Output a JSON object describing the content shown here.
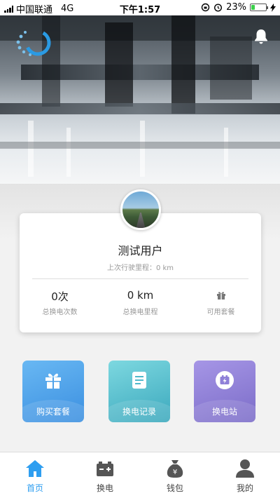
{
  "status_bar": {
    "carrier": "中国联通",
    "network": "4G",
    "time": "下午1:57",
    "battery_percent": "23%",
    "battery_level": 0.23
  },
  "header": {
    "logo_icon": "ring-logo-icon",
    "notification_icon": "bell-icon"
  },
  "profile": {
    "username": "测试用户",
    "last_mileage": "上次行驶里程：0 km",
    "stats": [
      {
        "value": "0次",
        "label": "总换电次数"
      },
      {
        "value": "0 km",
        "label": "总换电里程"
      },
      {
        "value": "",
        "label": "可用套餐",
        "icon": "gift-icon"
      }
    ]
  },
  "actions": [
    {
      "label": "购买套餐",
      "icon": "gift-icon",
      "color": "#4ea2ea"
    },
    {
      "label": "换电记录",
      "icon": "document-icon",
      "color": "#4fb9cb"
    },
    {
      "label": "换电站",
      "icon": "battery-station-icon",
      "color": "#8f80d8"
    }
  ],
  "tabbar": {
    "active_color": "#2e9ef0",
    "tabs": [
      {
        "label": "首页",
        "icon": "home-icon",
        "active": true
      },
      {
        "label": "换电",
        "icon": "battery-icon",
        "active": false
      },
      {
        "label": "钱包",
        "icon": "money-bag-icon",
        "active": false
      },
      {
        "label": "我的",
        "icon": "user-icon",
        "active": false
      }
    ]
  }
}
